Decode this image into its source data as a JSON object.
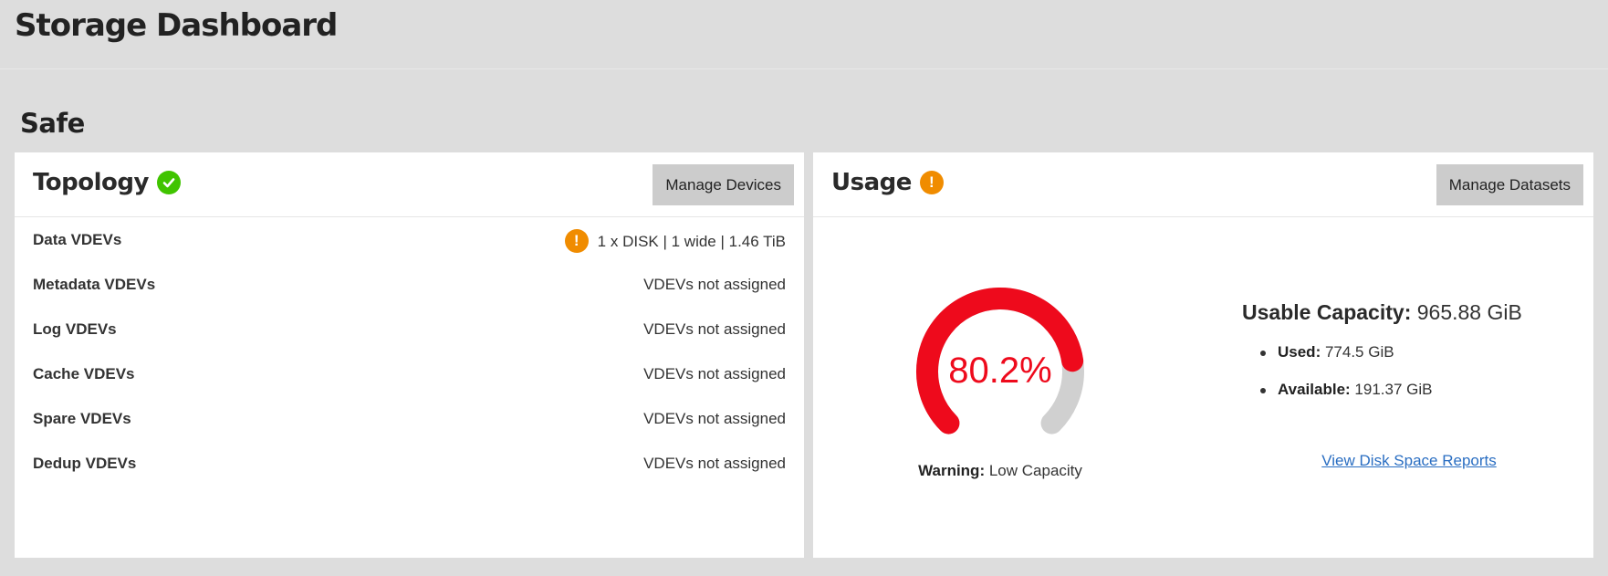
{
  "page": {
    "title": "Storage Dashboard"
  },
  "pool": {
    "name": "Safe"
  },
  "topology": {
    "title": "Topology",
    "status_icon": "check-circle-icon",
    "manage_label": "Manage Devices",
    "rows": [
      {
        "label": "Data VDEVs",
        "value": "1 x DISK | 1 wide | 1.46 TiB",
        "warning": true
      },
      {
        "label": "Metadata VDEVs",
        "value": "VDEVs not assigned",
        "warning": false
      },
      {
        "label": "Log VDEVs",
        "value": "VDEVs not assigned",
        "warning": false
      },
      {
        "label": "Cache VDEVs",
        "value": "VDEVs not assigned",
        "warning": false
      },
      {
        "label": "Spare VDEVs",
        "value": "VDEVs not assigned",
        "warning": false
      },
      {
        "label": "Dedup VDEVs",
        "value": "VDEVs not assigned",
        "warning": false
      }
    ]
  },
  "usage": {
    "title": "Usage",
    "status_icon": "warning-circle-icon",
    "manage_label": "Manage Datasets",
    "gauge": {
      "value": 80.2,
      "label": "80.2%"
    },
    "warning_label": "Warning:",
    "warning_text": "Low Capacity",
    "capacity_label": "Usable Capacity:",
    "capacity_value": "965.88 GiB",
    "used_label": "Used:",
    "used_value": "774.5 GiB",
    "available_label": "Available:",
    "available_value": "191.37 GiB",
    "report_link": "View Disk Space Reports"
  },
  "colors": {
    "ok": "#40c400",
    "warning": "#f08c00",
    "gauge_fill": "#ee0a1c",
    "gauge_track": "#d0d0d0",
    "link": "#2a6ec2"
  }
}
